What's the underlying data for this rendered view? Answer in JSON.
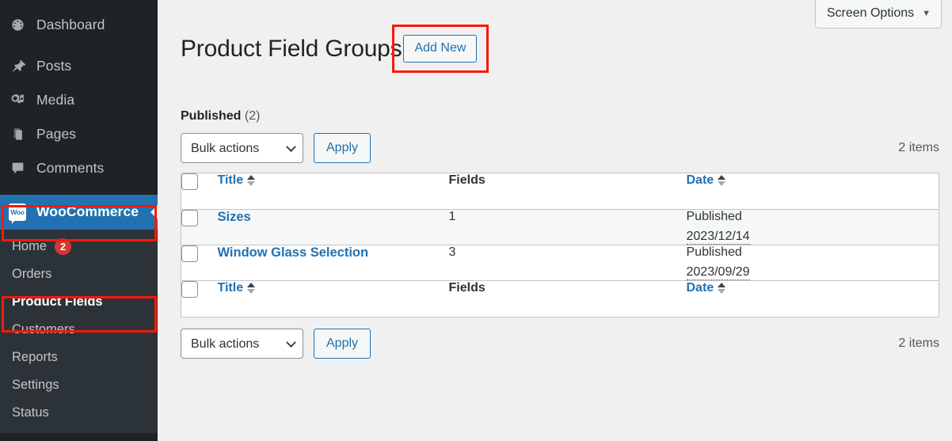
{
  "sidebar": {
    "items": [
      {
        "label": "Dashboard",
        "icon": "dashboard-icon"
      },
      {
        "label": "Posts",
        "icon": "pin-icon"
      },
      {
        "label": "Media",
        "icon": "media-icon"
      },
      {
        "label": "Pages",
        "icon": "pages-icon"
      },
      {
        "label": "Comments",
        "icon": "comments-icon"
      }
    ],
    "active": {
      "label": "WooCommerce",
      "icon": "woo-icon",
      "icon_text": "Woo",
      "background": "#2271b1"
    },
    "submenu": [
      {
        "label": "Home",
        "badge": "2"
      },
      {
        "label": "Orders",
        "badge": ""
      },
      {
        "label": "Product Fields",
        "badge": "",
        "current": true
      },
      {
        "label": "Customers",
        "badge": ""
      },
      {
        "label": "Reports",
        "badge": ""
      },
      {
        "label": "Settings",
        "badge": ""
      },
      {
        "label": "Status",
        "badge": ""
      }
    ],
    "colors": {
      "background": "#1d2327",
      "submenu_background": "#2c3338",
      "badge": "#d63638"
    }
  },
  "header": {
    "screen_options_label": "Screen Options",
    "screen_options_caret": "▼",
    "page_title": "Product Field Groups",
    "add_new_label": "Add New"
  },
  "highlight_color": "#f9180b",
  "list": {
    "status_filter": {
      "label": "Published",
      "count": "(2)"
    },
    "bulk_actions_value": "Bulk actions",
    "apply_label": "Apply",
    "item_count_top": "2 items",
    "item_count_bottom": "2 items",
    "columns": {
      "title": "Title",
      "fields": "Fields",
      "date": "Date"
    },
    "rows": [
      {
        "title": "Sizes",
        "fields": "1",
        "status": "Published",
        "date": "2023/12/14"
      },
      {
        "title": "Window Glass Selection",
        "fields": "3",
        "status": "Published",
        "date": "2023/09/29"
      }
    ]
  }
}
